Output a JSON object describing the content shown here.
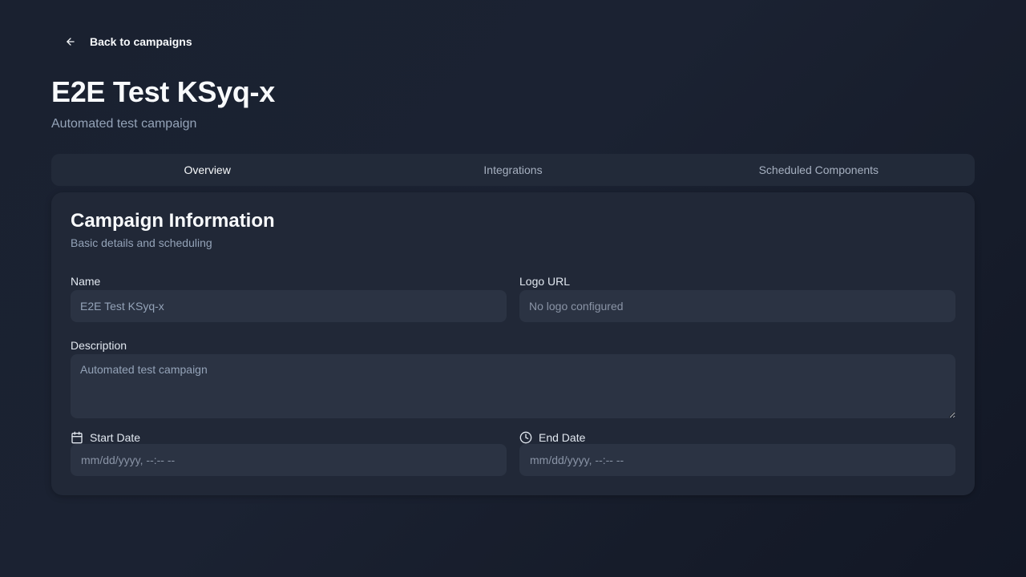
{
  "back": {
    "label": "Back to campaigns",
    "icon": "arrow-left-icon"
  },
  "page": {
    "title": "E2E Test KSyq-x",
    "subtitle": "Automated test campaign"
  },
  "tabs": [
    {
      "label": "Overview",
      "active": true
    },
    {
      "label": "Integrations",
      "active": false
    },
    {
      "label": "Scheduled Components",
      "active": false
    }
  ],
  "card": {
    "title": "Campaign Information",
    "description": "Basic details and scheduling"
  },
  "form": {
    "name": {
      "label": "Name",
      "value": "E2E Test KSyq-x"
    },
    "logo_url": {
      "label": "Logo URL",
      "placeholder": "No logo configured"
    },
    "description": {
      "label": "Description",
      "value": "Automated test campaign"
    },
    "start_date": {
      "label": "Start Date",
      "placeholder": "mm/dd/yyyy, --:-- --",
      "icon": "calendar-icon"
    },
    "end_date": {
      "label": "End Date",
      "placeholder": "mm/dd/yyyy, --:-- --",
      "icon": "clock-icon"
    }
  },
  "colors": {
    "background": "#1b2232",
    "card": "#212837",
    "input": "#2b3343",
    "muted_text": "#94a3b8"
  }
}
